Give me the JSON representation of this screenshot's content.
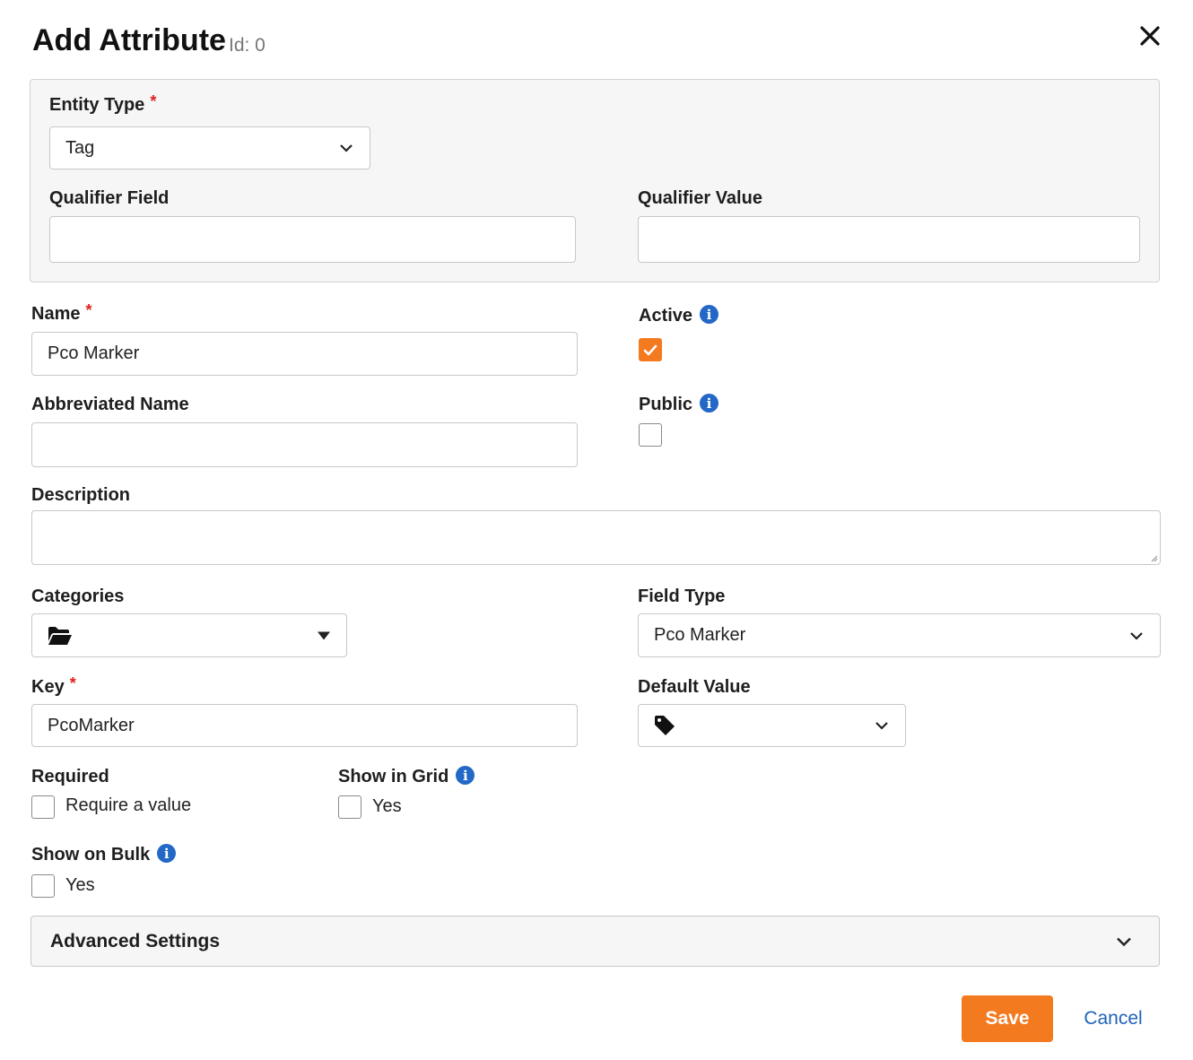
{
  "dialog": {
    "title": "Add Attribute",
    "id_label": "Id: 0"
  },
  "entity_type": {
    "label": "Entity Type",
    "required_mark": "*",
    "value": "Tag"
  },
  "qualifier_field": {
    "label": "Qualifier Field",
    "value": ""
  },
  "qualifier_value": {
    "label": "Qualifier Value",
    "value": ""
  },
  "name": {
    "label": "Name",
    "required_mark": "*",
    "value": "Pco Marker"
  },
  "active": {
    "label": "Active",
    "checked": true,
    "info": "i"
  },
  "abbreviated_name": {
    "label": "Abbreviated Name",
    "value": ""
  },
  "public": {
    "label": "Public",
    "checked": false,
    "info": "i"
  },
  "description": {
    "label": "Description",
    "value": ""
  },
  "categories": {
    "label": "Categories",
    "icon": "folder-open-icon"
  },
  "field_type": {
    "label": "Field Type",
    "value": "Pco Marker"
  },
  "key": {
    "label": "Key",
    "required_mark": "*",
    "value": "PcoMarker"
  },
  "default_value": {
    "label": "Default Value",
    "icon": "tag-icon"
  },
  "required": {
    "label": "Required",
    "option": "Require a value",
    "checked": false
  },
  "show_in_grid": {
    "label": "Show in Grid",
    "option": "Yes",
    "checked": false,
    "info": "i"
  },
  "show_on_bulk": {
    "label": "Show on Bulk",
    "option": "Yes",
    "checked": false,
    "info": "i"
  },
  "advanced_settings": {
    "label": "Advanced Settings"
  },
  "actions": {
    "save": "Save",
    "cancel": "Cancel"
  },
  "colors": {
    "accent": "#f47a20",
    "link": "#1f63b8",
    "info": "#2368c6",
    "required": "#e1201f"
  }
}
